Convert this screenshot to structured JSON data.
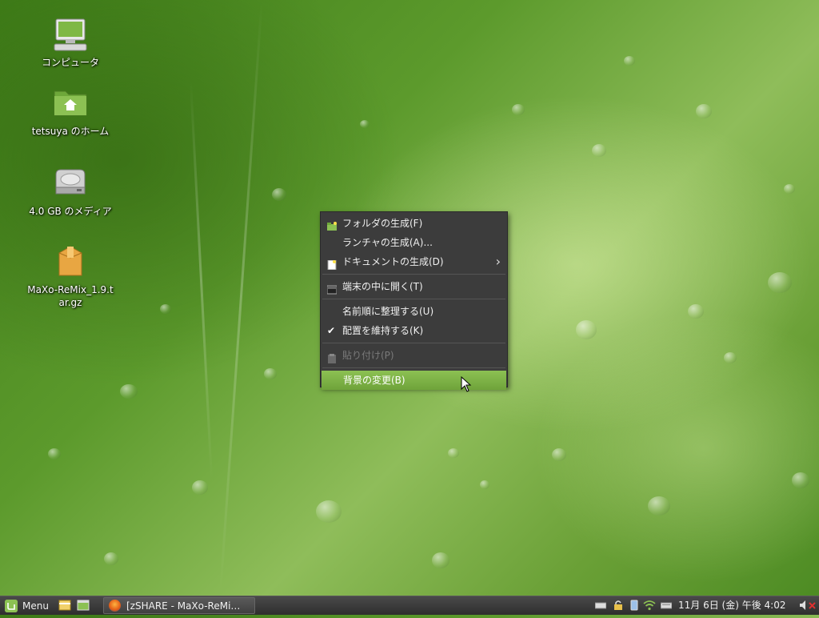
{
  "desktop": {
    "icons": [
      {
        "label": "コンピュータ",
        "icon": "computer-icon"
      },
      {
        "label": "tetsuya のホーム",
        "icon": "home-folder-icon"
      },
      {
        "label": "4.0 GB のメディア",
        "icon": "drive-icon"
      },
      {
        "label": "MaXo-ReMix_1.9.tar.gz",
        "icon": "archive-icon"
      }
    ]
  },
  "context_menu": {
    "items": [
      {
        "label": "フォルダの生成(F)",
        "icon": "new-folder-icon"
      },
      {
        "label": "ランチャの生成(A)..."
      },
      {
        "label": "ドキュメントの生成(D)",
        "icon": "new-document-icon",
        "submenu": true
      },
      {
        "label": "端末の中に開く(T)",
        "icon": "terminal-icon"
      },
      {
        "label": "名前順に整理する(U)"
      },
      {
        "label": "配置を維持する(K)",
        "checked": true
      },
      {
        "label": "貼り付け(P)",
        "icon": "paste-icon",
        "disabled": true
      },
      {
        "label": "背景の変更(B)",
        "selected": true
      }
    ]
  },
  "panel": {
    "menu_label": "Menu",
    "task_label": "[zSHARE - MaXo-ReMi…",
    "clock": "11月 6日 (金) 午後 4:02"
  },
  "colors": {
    "menu_background": "#3c3c3c",
    "selection": "#8cc153",
    "panel": "#3a3a3a"
  }
}
